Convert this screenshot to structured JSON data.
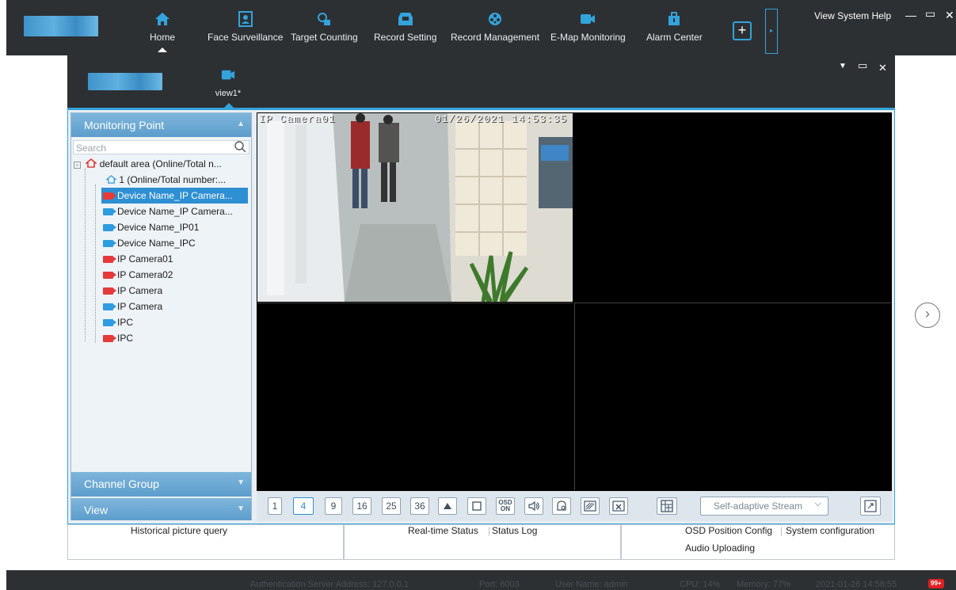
{
  "nav": {
    "items": [
      {
        "label": "Home",
        "icon": "home-icon"
      },
      {
        "label": "Face Surveillance",
        "icon": "face-icon"
      },
      {
        "label": "Target Counting",
        "icon": "target-icon"
      },
      {
        "label": "Record Setting",
        "icon": "record-icon"
      },
      {
        "label": "Record Management",
        "icon": "film-icon"
      },
      {
        "label": "E-Map Monitoring",
        "icon": "camera-icon"
      },
      {
        "label": "Alarm Center",
        "icon": "alarm-icon"
      }
    ],
    "menu_label": "View System Help"
  },
  "inner": {
    "tab_label": "view1*"
  },
  "left": {
    "monitoring_title": "Monitoring Point",
    "search_placeholder": "Search",
    "tree": [
      {
        "label": "default area (Online/Total n...",
        "kind": "area"
      },
      {
        "label": "1 (Online/Total number:...",
        "kind": "node"
      },
      {
        "label": "Device Name_IP Camera...",
        "kind": "cam",
        "color": "red",
        "selected": true
      },
      {
        "label": "Device Name_IP Camera...",
        "kind": "cam",
        "color": "blue"
      },
      {
        "label": "Device Name_IP01",
        "kind": "cam",
        "color": "blue"
      },
      {
        "label": "Device Name_IPC",
        "kind": "cam",
        "color": "blue"
      },
      {
        "label": "IP Camera01",
        "kind": "cam",
        "color": "red"
      },
      {
        "label": "IP Camera02",
        "kind": "cam",
        "color": "red"
      },
      {
        "label": "IP Camera",
        "kind": "cam",
        "color": "red"
      },
      {
        "label": "IP Camera",
        "kind": "cam",
        "color": "blue"
      },
      {
        "label": "IPC",
        "kind": "cam",
        "color": "blue"
      },
      {
        "label": "IPC",
        "kind": "cam",
        "color": "red"
      }
    ],
    "channel_group_title": "Channel Group",
    "view_title": "View"
  },
  "video": {
    "camera_label": "IP Camera01",
    "timestamp": "01/26/2021 14:53:35"
  },
  "toolbar": {
    "layouts": [
      "1",
      "4",
      "9",
      "16",
      "25",
      "36"
    ],
    "active_layout": "4",
    "osd_top": "OSD",
    "osd_bottom": "ON",
    "stream_select": "Self-adaptive Stream"
  },
  "bottom": {
    "panel1": "Historical picture query",
    "panel2_a": "Real-time Status",
    "panel2_b": "Status Log",
    "panel3_a": "OSD Position Config",
    "panel3_b": "System configuration",
    "panel3_c": "Audio Uploading"
  },
  "status": {
    "server": "Authentication Server  Address: 127.0.0.1",
    "port": "Port: 6003",
    "user": "User Name: admin",
    "cpu": "CPU: 14%",
    "memory": "Memory: 77%",
    "datetime": "2021-01-26 14:58:55",
    "alarm_badge": "99+"
  },
  "colors": {
    "accent": "#33a3dc",
    "dark_bar": "#2d3033",
    "selected_row": "#2f8fd3",
    "cam_online": "#2f9be0",
    "cam_offline": "#e53a3a"
  }
}
